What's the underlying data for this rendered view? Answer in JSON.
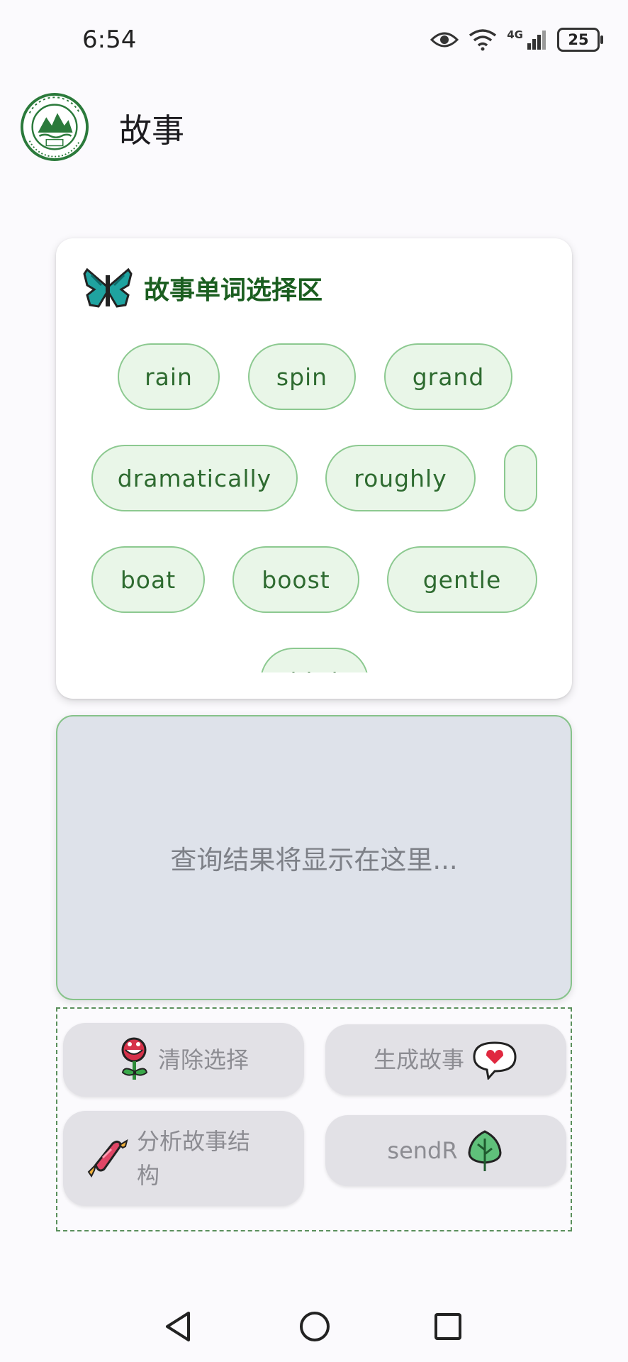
{
  "status_bar": {
    "time": "6:54",
    "network": "4G",
    "battery": "25"
  },
  "app_bar": {
    "title": "故事"
  },
  "word_panel": {
    "title": "故事单词选择区",
    "words": [
      "rain",
      "spin",
      "grand",
      "dramatically",
      "roughly",
      "",
      "boat",
      "boost",
      "gentle",
      "bird"
    ]
  },
  "result": {
    "placeholder": "查询结果将显示在这里..."
  },
  "actions": {
    "clear_label": "清除选择",
    "generate_label": "生成故事",
    "analyze_label": "分析故事结构",
    "send_label": "sendR"
  },
  "colors": {
    "accent": "#1b5e20",
    "chip_border": "#8cc990",
    "chip_fill": "#e9f6e8",
    "result_fill": "#dee2ea"
  }
}
